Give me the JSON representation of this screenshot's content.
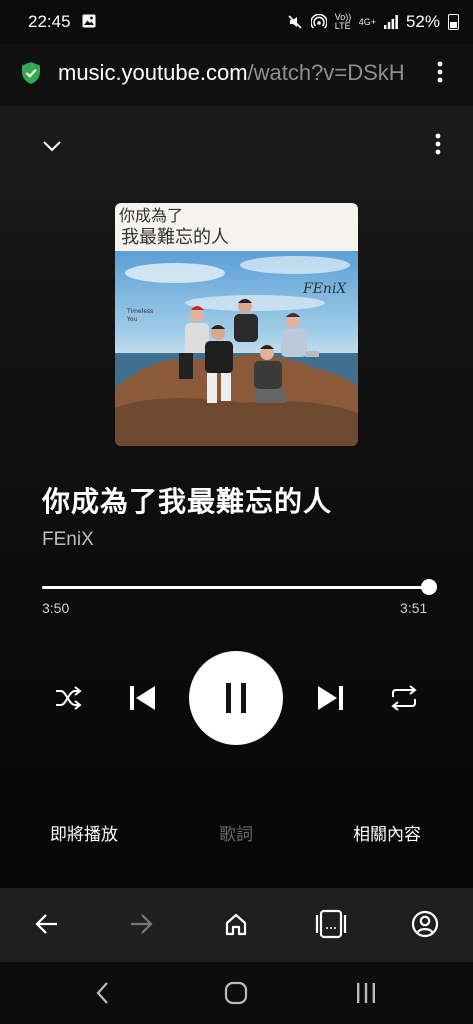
{
  "status": {
    "time": "22:45",
    "battery": "52%",
    "volte": "Vo)) LTE",
    "network": "4G+"
  },
  "browser": {
    "url_domain": "music.youtube.com",
    "url_path": "/watch?v=DSkH"
  },
  "album_art": {
    "title_line1": "你成為了",
    "title_line2": "我最難忘的人",
    "band_logo": "FEniX",
    "tagline_1": "Timeless",
    "tagline_2": "You"
  },
  "track": {
    "title": "你成為了我最難忘的人",
    "artist": "FEniX",
    "elapsed": "3:50",
    "duration": "3:51",
    "progress": 0.996
  },
  "tabs": [
    {
      "label": "即將播放",
      "active": true
    },
    {
      "label": "歌詞",
      "active": false
    },
    {
      "label": "相關內容",
      "active": true
    }
  ],
  "colors": {
    "background": "#000000",
    "secure_badge": "#34a853",
    "inactive_text": "#6b6b6b"
  },
  "icons": {
    "collapse": "chevron-down-icon",
    "menu": "more-vert-icon",
    "shuffle": "shuffle-icon",
    "previous": "skip-previous-icon",
    "pause": "pause-icon",
    "next": "skip-next-icon",
    "repeat": "repeat-icon",
    "back": "arrow-back-icon",
    "forward": "arrow-forward-icon",
    "home": "home-icon",
    "tabs": "tabs-icon",
    "account": "account-icon"
  }
}
